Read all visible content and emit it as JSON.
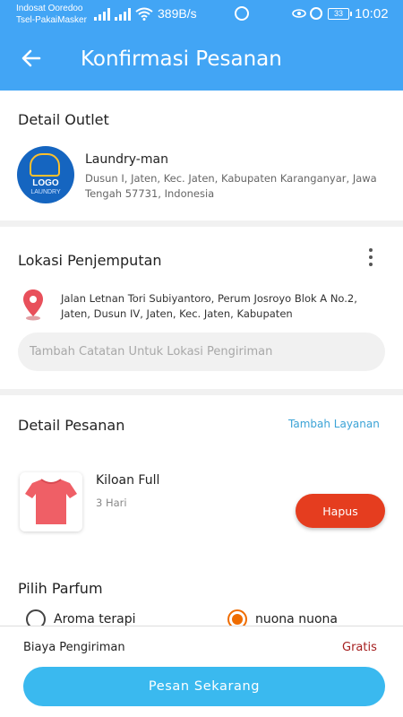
{
  "status_bar": {
    "carrier_1": "Indosat Ooredoo",
    "carrier_2": "Tsel-PakaiMasker",
    "net_speed": "389B/s",
    "battery": "33",
    "time": "10:02",
    "icons": [
      "signal-icon",
      "wifi-icon",
      "whatsapp-icon",
      "eye-icon",
      "alarm-icon",
      "battery-icon"
    ]
  },
  "header": {
    "title": "Konfirmasi Pesanan",
    "back_icon": "back-arrow-icon",
    "bg_color": "#42a5f5"
  },
  "outlet": {
    "section_title": "Detail Outlet",
    "logo_text": "LOGO",
    "logo_sub": "LAUNDRY",
    "name": "Laundry-man",
    "address": "Dusun I, Jaten, Kec. Jaten, Kabupaten Karanganyar, Jawa Tengah 57731, Indonesia"
  },
  "pickup": {
    "section_title": "Lokasi Penjemputan",
    "address": "Jalan Letnan Tori Subiyantoro, Perum Josroyo Blok A No.2, Jaten, Dusun IV, Jaten, Kec. Jaten, Kabupaten",
    "note_placeholder": "Tambah Catatan Untuk Lokasi Pengiriman",
    "pin_color": "#e8505b"
  },
  "order": {
    "section_title": "Detail Pesanan",
    "add_service": "Tambah Layanan",
    "items": [
      {
        "name": "Kiloan Full",
        "duration": "3 Hari",
        "delete_label": "Hapus"
      }
    ]
  },
  "parfum": {
    "section_title": "Pilih Parfum",
    "options": [
      {
        "label": "Aroma terapi",
        "selected": false
      },
      {
        "label": "nuona nuona",
        "selected": true
      }
    ]
  },
  "footer": {
    "shipping_label": "Biaya Pengiriman",
    "shipping_value": "Gratis",
    "order_button": "Pesan Sekarang",
    "accent": "#3ab9ef"
  }
}
